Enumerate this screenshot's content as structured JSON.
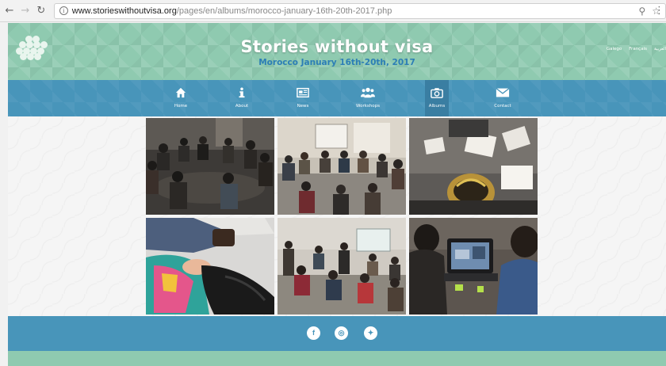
{
  "browser": {
    "url_host": "www.storieswithoutvisa.org",
    "url_path": "/pages/en/albums/morocco-january-16th-20th-2017.php",
    "icons": [
      "back-arrow-icon",
      "forward-arrow-icon",
      "reload-icon",
      "info-icon",
      "zoom-icon",
      "star-icon",
      "menu-icon"
    ]
  },
  "header": {
    "title": "Stories without visa",
    "subtitle": "Morocco January 16th-20th, 2017",
    "languages": [
      "Galego",
      "Français",
      "العربية"
    ]
  },
  "nav": {
    "items": [
      {
        "label": "Home",
        "icon": "home-icon"
      },
      {
        "label": "About",
        "icon": "info-icon"
      },
      {
        "label": "News",
        "icon": "newspaper-icon"
      },
      {
        "label": "Workshops",
        "icon": "users-icon"
      },
      {
        "label": "Albums",
        "icon": "camera-icon",
        "active": true
      },
      {
        "label": "Contact",
        "icon": "envelope-icon"
      }
    ]
  },
  "gallery": {
    "photos": [
      {
        "subject": "group seated in a circle in a dark room",
        "icon": "photo-icon"
      },
      {
        "subject": "workshop group in a circle with whiteboard",
        "icon": "photo-icon"
      },
      {
        "subject": "people writing on papers at a table",
        "icon": "photo-icon"
      },
      {
        "subject": "crossed legs and colorful bag",
        "icon": "photo-icon"
      },
      {
        "subject": "group around tables with projector screen",
        "icon": "photo-icon"
      },
      {
        "subject": "man editing video on a laptop",
        "icon": "photo-icon"
      }
    ]
  },
  "footer": {
    "social": [
      {
        "name": "facebook",
        "glyph": "f"
      },
      {
        "name": "instagram",
        "glyph": "◎"
      },
      {
        "name": "twitter",
        "glyph": "✦"
      }
    ]
  },
  "colors": {
    "header_bg": "#8fcab0",
    "nav_bg": "#4895ba",
    "subtitle": "#2c7eb6"
  }
}
